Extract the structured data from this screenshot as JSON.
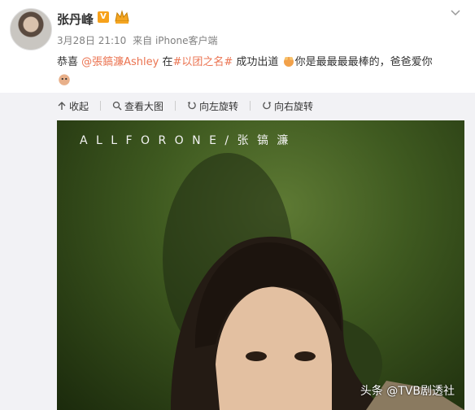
{
  "post": {
    "username": "张丹峰",
    "vip_label": "V",
    "timestamp": "3月28日 21:10",
    "source": "来自 iPhone客户端",
    "text_before": "恭喜 ",
    "mention": "@張鎬濂Ashley",
    "text_mid": " 在",
    "topic": "#以团之名#",
    "text_after": " 成功出道",
    "text_end": "你是最最最最棒的，爸爸爱你"
  },
  "toolbar": {
    "collapse": "收起",
    "view_large": "查看大图",
    "rotate_left": "向左旋转",
    "rotate_right": "向右旋转"
  },
  "photo": {
    "title": "A L L    F O R    O N E / 张 镐 濂",
    "watermark": "头条 @TVB剧透社"
  },
  "icons": [
    "vip-badge",
    "crown-icon",
    "menu-chevron-icon",
    "collapse-icon",
    "zoom-icon",
    "rotate-left-icon",
    "rotate-right-icon"
  ],
  "colors": {
    "accent": "#eb7350",
    "meta": "#808080"
  }
}
